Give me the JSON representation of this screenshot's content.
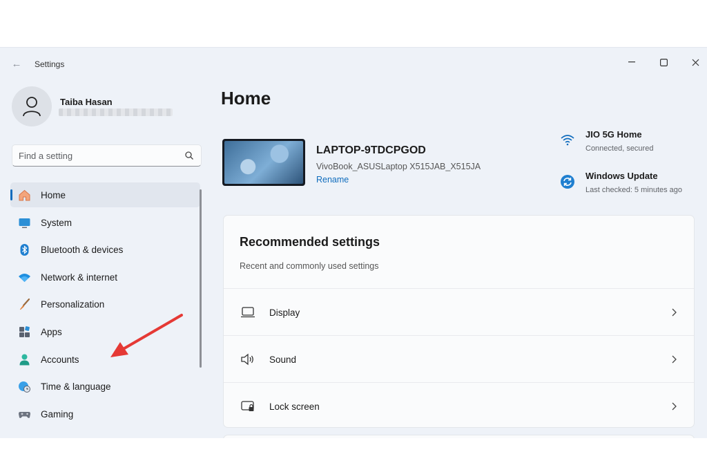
{
  "window": {
    "title": "Settings"
  },
  "user": {
    "name": "Taiba Hasan"
  },
  "search": {
    "placeholder": "Find a setting"
  },
  "nav": {
    "items": [
      {
        "label": "Home",
        "icon": "home-icon",
        "active": true
      },
      {
        "label": "System",
        "icon": "system-icon"
      },
      {
        "label": "Bluetooth & devices",
        "icon": "bluetooth-icon"
      },
      {
        "label": "Network & internet",
        "icon": "wifi-icon"
      },
      {
        "label": "Personalization",
        "icon": "brush-icon"
      },
      {
        "label": "Apps",
        "icon": "apps-icon"
      },
      {
        "label": "Accounts",
        "icon": "accounts-icon"
      },
      {
        "label": "Time & language",
        "icon": "globe-clock-icon"
      },
      {
        "label": "Gaming",
        "icon": "gamepad-icon"
      }
    ]
  },
  "main": {
    "title": "Home",
    "device": {
      "name": "LAPTOP-9TDCPGOD",
      "model": "VivoBook_ASUSLaptop X515JAB_X515JA",
      "rename": "Rename"
    },
    "status": {
      "network": {
        "title": "JIO 5G Home",
        "sub": "Connected, secured",
        "icon": "wifi-icon"
      },
      "update": {
        "title": "Windows Update",
        "sub": "Last checked: 5 minutes ago",
        "icon": "update-icon"
      }
    },
    "recommended": {
      "title": "Recommended settings",
      "subtitle": "Recent and commonly used settings",
      "rows": [
        {
          "label": "Display",
          "icon": "display-icon"
        },
        {
          "label": "Sound",
          "icon": "speaker-icon"
        },
        {
          "label": "Lock screen",
          "icon": "lock-screen-icon"
        }
      ]
    }
  },
  "colors": {
    "accent": "#0f6cbd",
    "window_bg": "#eef2f8",
    "card_bg": "#fafbfc",
    "annotation": "#e53935"
  }
}
